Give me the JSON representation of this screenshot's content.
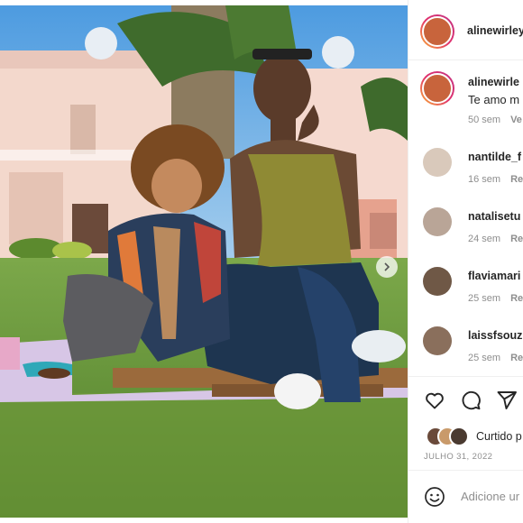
{
  "post": {
    "author": "alinewirley",
    "caption": {
      "username": "alinewirle",
      "text": "Te amo m",
      "age": "50 sem",
      "action": "Ve"
    },
    "comments": [
      {
        "username": "nantilde_f",
        "age": "16 sem",
        "action": "Re"
      },
      {
        "username": "natalisetu",
        "age": "24 sem",
        "action": "Re"
      },
      {
        "username": "flaviamari",
        "age": "25 sem",
        "action": "Re"
      },
      {
        "username": "laissfsouz",
        "age": "25 sem",
        "action": "Re"
      }
    ],
    "likes_text": "Curtido p",
    "date": "JULHO 31, 2022",
    "add_comment_placeholder": "Adicione ur"
  },
  "icons": {
    "like": "heart-icon",
    "comment": "speech-bubble-icon",
    "share": "paper-plane-icon",
    "emoji": "smiley-icon",
    "next": "chevron-right-icon"
  },
  "colors": {
    "story_ring_start": "#f9b234",
    "story_ring_end": "#c13584",
    "text": "#262626",
    "muted": "#8e8e8e"
  }
}
